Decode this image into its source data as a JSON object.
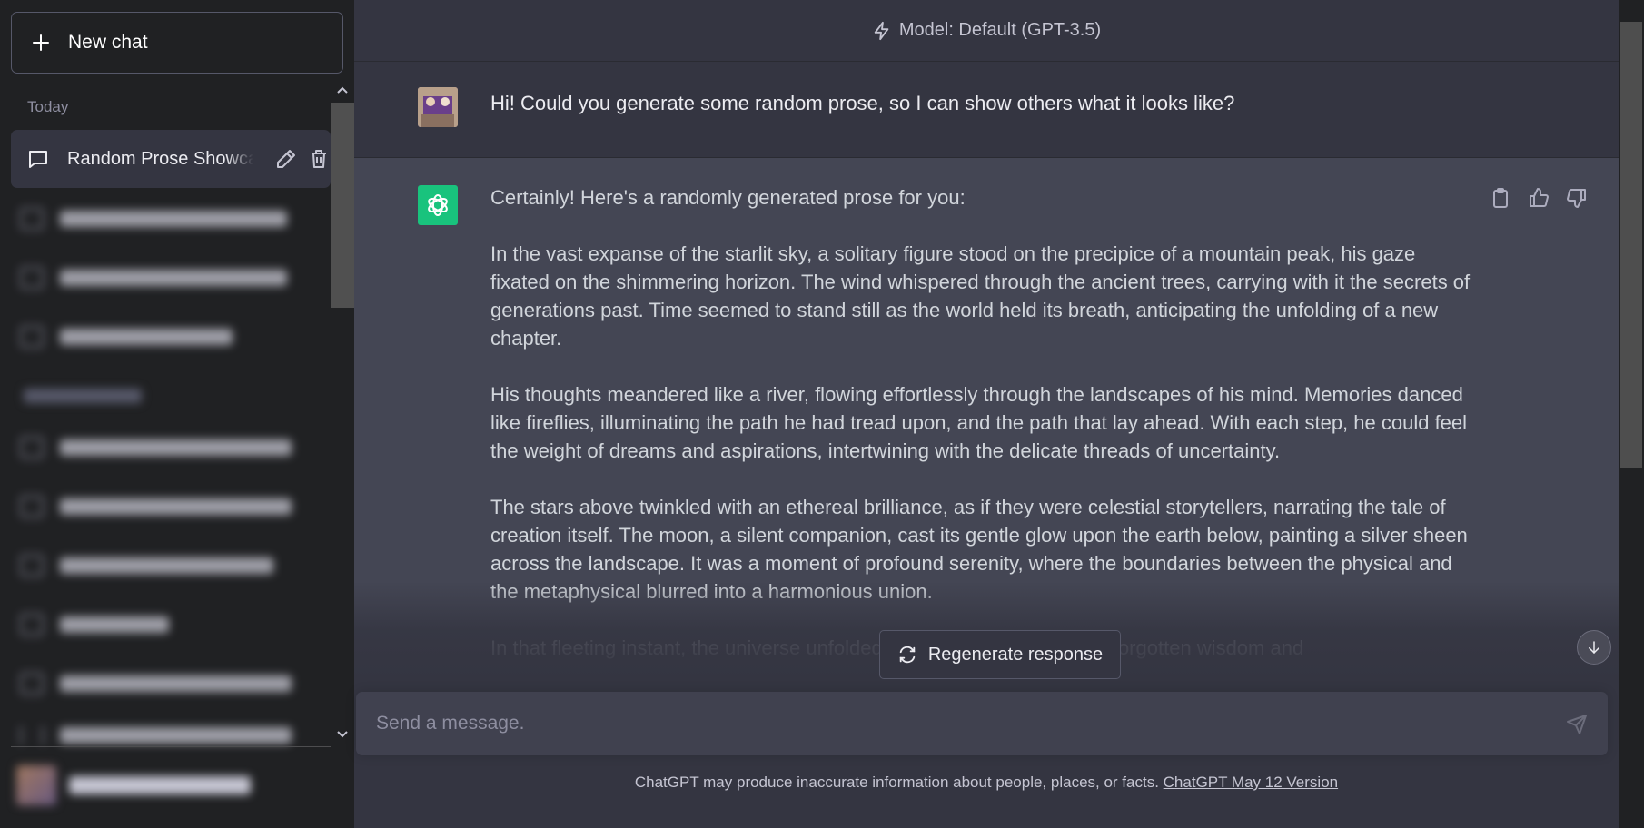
{
  "sidebar": {
    "new_chat_label": "New chat",
    "section_today": "Today",
    "active_chat_title": "Random Prose Showcase"
  },
  "header": {
    "model_label": "Model: Default (GPT-3.5)"
  },
  "conversation": {
    "user_message": "Hi! Could you generate some random prose, so I can show others what it looks like?",
    "assistant_paragraphs": [
      "Certainly! Here's a randomly generated prose for you:",
      "In the vast expanse of the starlit sky, a solitary figure stood on the precipice of a mountain peak, his gaze fixated on the shimmering horizon. The wind whispered through the ancient trees, carrying with it the secrets of generations past. Time seemed to stand still as the world held its breath, anticipating the unfolding of a new chapter.",
      "His thoughts meandered like a river, flowing effortlessly through the landscapes of his mind. Memories danced like fireflies, illuminating the path he had tread upon, and the path that lay ahead. With each step, he could feel the weight of dreams and aspirations, intertwining with the delicate threads of uncertainty.",
      "The stars above twinkled with an ethereal brilliance, as if they were celestial storytellers, narrating the tale of creation itself. The moon, a silent companion, cast its gentle glow upon the earth below, painting a silver sheen across the landscape. It was a moment of profound serenity, where the boundaries between the physical and the metaphysical blurred into a harmonious union.",
      "In that fleeting instant, the universe unfolded its secrets, whispering of forgotten wisdom and"
    ]
  },
  "controls": {
    "regenerate_label": "Regenerate response",
    "input_placeholder": "Send a message."
  },
  "footer": {
    "disclaimer": "ChatGPT may produce inaccurate information about people, places, or facts. ",
    "version_link": "ChatGPT May 12 Version"
  },
  "icons": {
    "model": "lightning-icon",
    "copy": "clipboard-icon",
    "like": "thumbs-up-icon",
    "dislike": "thumbs-down-icon",
    "send": "send-icon",
    "regenerate": "refresh-icon",
    "scroll_down": "arrow-down-icon"
  },
  "colors": {
    "sidebar_bg": "#202123",
    "main_bg": "#343541",
    "assistant_bg": "#444654",
    "gpt_green": "#19c37d",
    "input_bg": "#40414f"
  }
}
